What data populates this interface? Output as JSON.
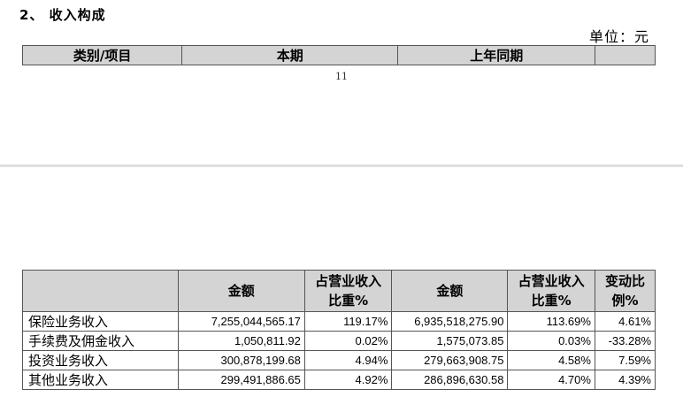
{
  "section_title": "2、 收入构成",
  "unit_label": "单位：元",
  "top_header": {
    "col1": "类别/项目",
    "col2": "本期",
    "col3": "上年同期",
    "col4": ""
  },
  "page_number": "11",
  "table": {
    "headers": [
      "",
      "金额",
      "占营业收入比重%",
      "金额",
      "占营业收入比重%",
      "变动比例%"
    ],
    "rows": [
      {
        "label": "保险业务收入",
        "cur_amount": "7,255,044,565.17",
        "cur_pct": "119.17%",
        "prev_amount": "6,935,518,275.90",
        "prev_pct": "113.69%",
        "change": "4.61%"
      },
      {
        "label": "手续费及佣金收入",
        "cur_amount": "1,050,811.92",
        "cur_pct": "0.02%",
        "prev_amount": "1,575,073.85",
        "prev_pct": "0.03%",
        "change": "-33.28%"
      },
      {
        "label": "投资业务收入",
        "cur_amount": "300,878,199.68",
        "cur_pct": "4.94%",
        "prev_amount": "279,663,908.75",
        "prev_pct": "4.58%",
        "change": "7.59%"
      },
      {
        "label": "其他业务收入",
        "cur_amount": "299,491,886.65",
        "cur_pct": "4.92%",
        "prev_amount": "286,896,630.58",
        "prev_pct": "4.70%",
        "change": "4.39%"
      }
    ]
  }
}
